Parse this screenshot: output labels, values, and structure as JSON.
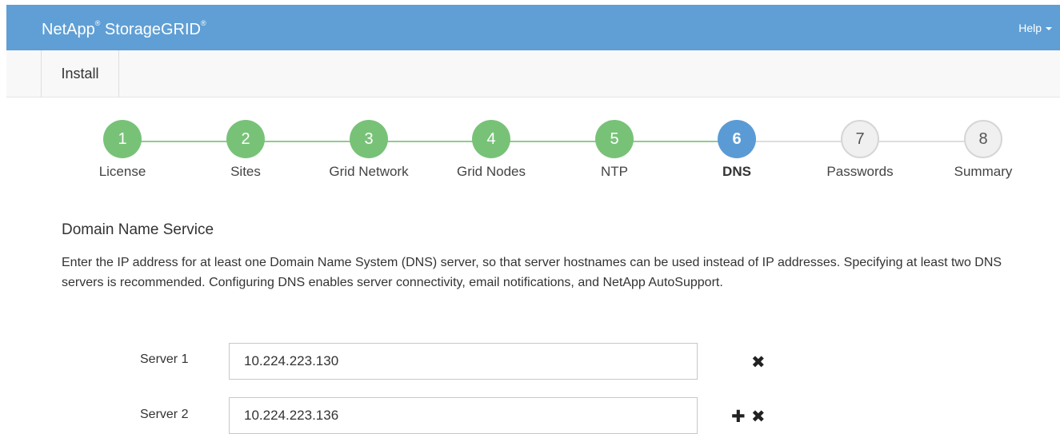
{
  "header": {
    "brand": "NetApp",
    "brand_reg": "®",
    "product": " StorageGRID",
    "product_reg": "®",
    "help_label": "Help"
  },
  "nav": {
    "tab_install": "Install"
  },
  "steps": [
    {
      "num": "1",
      "label": "License",
      "state": "done"
    },
    {
      "num": "2",
      "label": "Sites",
      "state": "done"
    },
    {
      "num": "3",
      "label": "Grid Network",
      "state": "done"
    },
    {
      "num": "4",
      "label": "Grid Nodes",
      "state": "done"
    },
    {
      "num": "5",
      "label": "NTP",
      "state": "done"
    },
    {
      "num": "6",
      "label": "DNS",
      "state": "active"
    },
    {
      "num": "7",
      "label": "Passwords",
      "state": "todo"
    },
    {
      "num": "8",
      "label": "Summary",
      "state": "todo"
    }
  ],
  "content": {
    "title": "Domain Name Service",
    "description": "Enter the IP address for at least one Domain Name System (DNS) server, so that server hostnames can be used instead of IP addresses. Specifying at least two DNS servers is recommended. Configuring DNS enables server connectivity, email notifications, and NetApp AutoSupport."
  },
  "servers": [
    {
      "label": "Server 1",
      "value": "10.224.223.130"
    },
    {
      "label": "Server 2",
      "value": "10.224.223.136"
    }
  ],
  "icons": {
    "remove": "✖",
    "add": "✚"
  },
  "colors": {
    "header": "#5f9fd5",
    "done": "#78c278",
    "active": "#5b9bd5"
  }
}
